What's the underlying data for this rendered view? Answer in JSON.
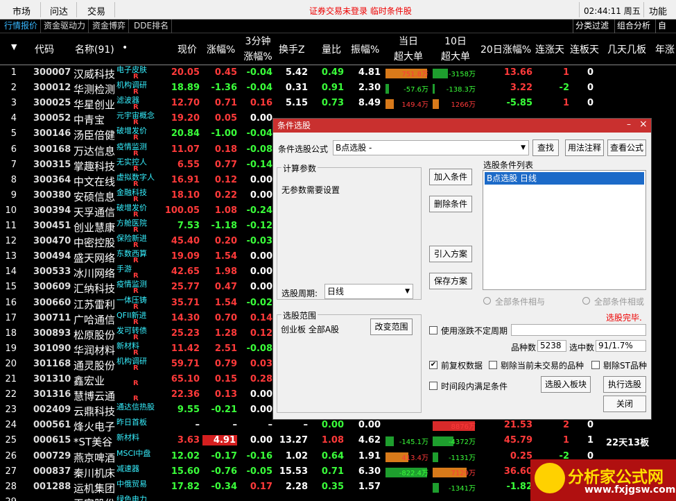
{
  "topbar": {
    "menu": [
      "市场",
      "问达",
      "交易"
    ],
    "notice": "证券交易未登录 临时条件股",
    "clock": "02:44:11 周五",
    "func": "功能"
  },
  "tabs": [
    "行情报价",
    "资金驱动力",
    "资金博弈",
    "DDE排名"
  ],
  "tabs_right": [
    "分类过滤",
    "组合分析",
    "自选"
  ],
  "header": {
    "arrow": "▼",
    "code": "代码",
    "name": "名称(91)",
    "dot": "•",
    "price": "现价",
    "chg": "涨幅%",
    "m3a": "3分钟",
    "m3b": "涨幅%",
    "turnover": "换手Z",
    "vr": "量比",
    "amp": "振幅%",
    "bigA1": "当日",
    "bigA2": "超大单",
    "big10a": "10日",
    "big10b": "超大单",
    "d20": "20日涨幅%",
    "lz": "连涨天",
    "lb": "连板天",
    "jt": "几天几板",
    "nian": "年涨"
  },
  "rows": [
    {
      "n": "1",
      "code": "300007",
      "name": "汉威科技",
      "tag": "电子皮肤",
      "price": "20.05",
      "chg": "0.45",
      "m3": "-0.04",
      "to": "5.42",
      "vr": "0.49",
      "amp": "4.81",
      "b1": "751.8万",
      "b1v": 751.8,
      "b10": "-3158万",
      "b10v": -3158,
      "d20": "13.66",
      "lz": "1",
      "lb": "0",
      "jt": "",
      "r": true
    },
    {
      "n": "2",
      "code": "300012",
      "name": "华测检测",
      "tag": "机构调研",
      "price": "18.89",
      "chg": "-1.36",
      "m3": "-0.04",
      "to": "0.31",
      "vr": "0.91",
      "amp": "2.30",
      "b1": "-57.6万",
      "b1v": -57.6,
      "b10": "-138.3万",
      "b10v": -138.3,
      "d20": "3.22",
      "lz": "-2",
      "lb": "0",
      "jt": "",
      "r": true
    },
    {
      "n": "3",
      "code": "300025",
      "name": "华星创业",
      "tag": "滤波器",
      "price": "12.70",
      "chg": "0.71",
      "m3": "0.16",
      "to": "5.15",
      "vr": "0.73",
      "amp": "8.49",
      "b1": "149.4万",
      "b1v": 149.4,
      "b10": "1266万",
      "b10v": 1266,
      "d20": "-5.85",
      "lz": "1",
      "lb": "0",
      "jt": "",
      "r": true
    },
    {
      "n": "4",
      "code": "300052",
      "name": "中青宝",
      "tag": "元宇宙概念",
      "price": "19.20",
      "chg": "0.05",
      "m3": "0.00",
      "to": "",
      "vr": "",
      "amp": "",
      "b1": "",
      "b1v": 0,
      "b10": "",
      "b10v": 0,
      "d20": "",
      "lz": "",
      "lb": "",
      "jt": "",
      "r": true
    },
    {
      "n": "5",
      "code": "300146",
      "name": "汤臣倍健",
      "tag": "破增发价",
      "price": "20.84",
      "chg": "-1.00",
      "m3": "-0.04",
      "to": "",
      "vr": "",
      "amp": "",
      "b1": "",
      "b1v": 0,
      "b10": "",
      "b10v": 0,
      "d20": "",
      "lz": "",
      "lb": "",
      "jt": "",
      "r": true
    },
    {
      "n": "6",
      "code": "300168",
      "name": "万达信息",
      "tag": "疫情监测",
      "price": "11.07",
      "chg": "0.18",
      "m3": "-0.08",
      "to": "",
      "vr": "",
      "amp": "",
      "b1": "",
      "b1v": 0,
      "b10": "",
      "b10v": 0,
      "d20": "",
      "lz": "",
      "lb": "",
      "jt": "",
      "r": true
    },
    {
      "n": "7",
      "code": "300315",
      "name": "掌趣科技",
      "tag": "无实控人",
      "price": "6.55",
      "chg": "0.77",
      "m3": "-0.14",
      "to": "",
      "vr": "",
      "amp": "",
      "b1": "",
      "b1v": 0,
      "b10": "",
      "b10v": 0,
      "d20": "",
      "lz": "",
      "lb": "",
      "jt": "",
      "r": true
    },
    {
      "n": "8",
      "code": "300364",
      "name": "中文在线",
      "tag": "虚拟数字人",
      "price": "16.91",
      "chg": "0.12",
      "m3": "0.00",
      "to": "",
      "vr": "",
      "amp": "",
      "b1": "",
      "b1v": 0,
      "b10": "",
      "b10v": 0,
      "d20": "",
      "lz": "",
      "lb": "",
      "jt": "",
      "r": true
    },
    {
      "n": "9",
      "code": "300380",
      "name": "安硕信息",
      "tag": "金融科技",
      "price": "18.10",
      "chg": "0.22",
      "m3": "0.00",
      "to": "",
      "vr": "",
      "amp": "",
      "b1": "",
      "b1v": 0,
      "b10": "",
      "b10v": 0,
      "d20": "",
      "lz": "",
      "lb": "",
      "jt": "",
      "r": true
    },
    {
      "n": "10",
      "code": "300394",
      "name": "天孚通信",
      "tag": "破增发价",
      "price": "100.05",
      "chg": "1.08",
      "m3": "-0.24",
      "to": "",
      "vr": "",
      "amp": "",
      "b1": "",
      "b1v": 0,
      "b10": "",
      "b10v": 0,
      "d20": "",
      "lz": "",
      "lb": "",
      "jt": "",
      "r": true
    },
    {
      "n": "11",
      "code": "300451",
      "name": "创业慧康",
      "tag": "方舱医院",
      "price": "7.53",
      "chg": "-1.18",
      "m3": "-0.12",
      "to": "",
      "vr": "",
      "amp": "",
      "b1": "",
      "b1v": 0,
      "b10": "",
      "b10v": 0,
      "d20": "",
      "lz": "",
      "lb": "",
      "jt": "",
      "r": true
    },
    {
      "n": "12",
      "code": "300470",
      "name": "中密控股",
      "tag": "保险新进",
      "price": "45.40",
      "chg": "0.20",
      "m3": "-0.03",
      "to": "",
      "vr": "",
      "amp": "",
      "b1": "",
      "b1v": 0,
      "b10": "",
      "b10v": 0,
      "d20": "",
      "lz": "",
      "lb": "",
      "jt": "",
      "r": true
    },
    {
      "n": "13",
      "code": "300494",
      "name": "盛天网络",
      "tag": "东数西算",
      "price": "19.09",
      "chg": "1.54",
      "m3": "0.00",
      "to": "",
      "vr": "",
      "amp": "",
      "b1": "",
      "b1v": 0,
      "b10": "",
      "b10v": 0,
      "d20": "",
      "lz": "",
      "lb": "",
      "jt": "",
      "r": true
    },
    {
      "n": "14",
      "code": "300533",
      "name": "冰川网络",
      "tag": "手游",
      "price": "42.65",
      "chg": "1.98",
      "m3": "0.00",
      "to": "",
      "vr": "",
      "amp": "",
      "b1": "",
      "b1v": 0,
      "b10": "",
      "b10v": 0,
      "d20": "",
      "lz": "",
      "lb": "",
      "jt": "",
      "r": true
    },
    {
      "n": "15",
      "code": "300609",
      "name": "汇纳科技",
      "tag": "疫情监测",
      "price": "25.77",
      "chg": "0.47",
      "m3": "0.00",
      "to": "",
      "vr": "",
      "amp": "",
      "b1": "",
      "b1v": 0,
      "b10": "",
      "b10v": 0,
      "d20": "",
      "lz": "",
      "lb": "",
      "jt": "",
      "r": true
    },
    {
      "n": "16",
      "code": "300660",
      "name": "江苏雷利",
      "tag": "一体压铸",
      "price": "35.71",
      "chg": "1.54",
      "m3": "-0.02",
      "to": "",
      "vr": "",
      "amp": "",
      "b1": "",
      "b1v": 0,
      "b10": "",
      "b10v": 0,
      "d20": "",
      "lz": "",
      "lb": "",
      "jt": "",
      "r": true
    },
    {
      "n": "17",
      "code": "300711",
      "name": "广哈通信",
      "tag": "QFII新进",
      "price": "14.30",
      "chg": "0.70",
      "m3": "0.14",
      "to": "",
      "vr": "",
      "amp": "",
      "b1": "",
      "b1v": 0,
      "b10": "",
      "b10v": 0,
      "d20": "",
      "lz": "",
      "lb": "",
      "jt": "",
      "r": true
    },
    {
      "n": "18",
      "code": "300893",
      "name": "松原股份",
      "tag": "发可转债",
      "price": "25.23",
      "chg": "1.28",
      "m3": "0.12",
      "to": "",
      "vr": "",
      "amp": "",
      "b1": "",
      "b1v": 0,
      "b10": "",
      "b10v": 0,
      "d20": "",
      "lz": "",
      "lb": "",
      "jt": "",
      "r": true
    },
    {
      "n": "19",
      "code": "301090",
      "name": "华润材料",
      "tag": "新材料",
      "price": "11.42",
      "chg": "2.51",
      "m3": "-0.08",
      "to": "",
      "vr": "",
      "amp": "",
      "b1": "",
      "b1v": 0,
      "b10": "",
      "b10v": 0,
      "d20": "",
      "lz": "",
      "lb": "",
      "jt": "",
      "r": true
    },
    {
      "n": "20",
      "code": "301168",
      "name": "通灵股份",
      "tag": "机构调研",
      "price": "59.71",
      "chg": "0.79",
      "m3": "0.03",
      "to": "",
      "vr": "",
      "amp": "",
      "b1": "",
      "b1v": 0,
      "b10": "",
      "b10v": 0,
      "d20": "",
      "lz": "",
      "lb": "",
      "jt": "",
      "r": true
    },
    {
      "n": "21",
      "code": "301310",
      "name": "鑫宏业",
      "tag": "",
      "price": "65.10",
      "chg": "0.15",
      "m3": "0.28",
      "to": "",
      "vr": "",
      "amp": "",
      "b1": "",
      "b1v": 0,
      "b10": "",
      "b10v": 0,
      "d20": "",
      "lz": "",
      "lb": "",
      "jt": "",
      "r": true
    },
    {
      "n": "22",
      "code": "301316",
      "name": "慧博云通",
      "tag": "",
      "price": "22.36",
      "chg": "0.13",
      "m3": "0.00",
      "to": "",
      "vr": "",
      "amp": "",
      "b1": "",
      "b1v": 0,
      "b10": "",
      "b10v": 0,
      "d20": "",
      "lz": "",
      "lb": "",
      "jt": "",
      "r": true
    },
    {
      "n": "23",
      "code": "002409",
      "name": "云鼎科技",
      "tag": "通达信热股",
      "price": "9.55",
      "chg": "-0.21",
      "m3": "0.00",
      "to": "",
      "vr": "",
      "amp": "",
      "b1": "",
      "b1v": 0,
      "b10": "",
      "b10v": 0,
      "d20": "",
      "lz": "",
      "lb": "",
      "jt": "",
      "r": false
    },
    {
      "n": "24",
      "code": "000561",
      "name": "烽火电子",
      "tag": "昨日首板",
      "price": "–",
      "chg": "–",
      "m3": "–",
      "to": "–",
      "vr": "0.00",
      "amp": "0.00",
      "b1": "",
      "b1v": 0,
      "b10": "8876万",
      "b10v": 8876,
      "d20": "21.53",
      "lz": "2",
      "lb": "0",
      "jt": "",
      "r": false
    },
    {
      "n": "25",
      "code": "000615",
      "name": "*ST美谷",
      "tag": "新材料",
      "price": "3.63",
      "chg": "4.91",
      "m3": "0.00",
      "to": "13.27",
      "vr": "1.08",
      "amp": "4.62",
      "b1": "-145.1万",
      "b1v": -145.1,
      "b10": "-4372万",
      "b10v": -4372,
      "d20": "45.79",
      "lz": "1",
      "lb": "1",
      "jt": "22天13板",
      "r": false
    },
    {
      "n": "26",
      "code": "000729",
      "name": "燕京啤酒",
      "tag": "MSCI中盘",
      "price": "12.02",
      "chg": "-0.17",
      "m3": "-0.16",
      "to": "1.02",
      "vr": "0.64",
      "amp": "1.91",
      "b1": "413.4万",
      "b1v": 413.4,
      "b10": "-1131万",
      "b10v": -1131,
      "d20": "0.25",
      "lz": "-2",
      "lb": "0",
      "jt": "",
      "r": false
    },
    {
      "n": "27",
      "code": "000837",
      "name": "秦川机床",
      "tag": "减速器",
      "price": "15.60",
      "chg": "-0.76",
      "m3": "-0.05",
      "to": "15.53",
      "vr": "0.71",
      "amp": "6.30",
      "b1": "-822.4万",
      "b1v": -822.4,
      "b10": "7129万",
      "b10v": 7129,
      "d20": "36.60",
      "lz": "",
      "lb": "",
      "jt": "",
      "r": false
    },
    {
      "n": "28",
      "code": "001288",
      "name": "运机集团",
      "tag": "中俄贸易",
      "price": "17.82",
      "chg": "-0.34",
      "m3": "0.17",
      "to": "2.28",
      "vr": "0.35",
      "amp": "1.57",
      "b1": "",
      "b1v": 0,
      "b10": "-1341万",
      "b10v": -1341,
      "d20": "-1.82",
      "lz": "",
      "lb": "",
      "jt": "",
      "r": false
    },
    {
      "n": "29",
      "code": "",
      "name": "天安股份",
      "tag": "绿色电力",
      "price": "",
      "chg": "",
      "m3": "",
      "to": "",
      "vr": "",
      "amp": "",
      "b1": "",
      "b1v": 0,
      "b10": "",
      "b10v": 0,
      "d20": "",
      "lz": "",
      "lb": "",
      "jt": "",
      "r": false
    }
  ],
  "dialog": {
    "title": "条件选股",
    "min": "–",
    "close": "×",
    "formula_label": "条件选股公式",
    "formula_value": "B点选股      -",
    "btn_find": "查找",
    "btn_usage": "用法注释",
    "btn_view": "查看公式",
    "calc_label": "计算参数",
    "no_params": "无参数需要设置",
    "period_label": "选股周期:",
    "period_value": "日线",
    "btn_add": "加入条件",
    "btn_del": "删除条件",
    "btn_import": "引入方案",
    "btn_save": "保存方案",
    "list_label": "选股条件列表",
    "list_item": "B点选股  日线",
    "radio_and": "全部条件相与",
    "radio_or": "全部条件相或",
    "status": "选股完毕.",
    "scope_label": "选股范围",
    "scope_value": "创业板 全部A股",
    "btn_scope": "改变范围",
    "cb_uncertain": "使用涨跌不定周期",
    "count_label": "品种数",
    "count_value": "5238",
    "hit_label": "选中数",
    "hit_value": "91/1.7%",
    "cb_restore": "前复权数据",
    "cb_exclude": "剔除当前未交易的品种",
    "cb_st": "剔除ST品种",
    "cb_period": "时间段内满足条件",
    "btn_board": "选股入板块",
    "btn_run": "执行选股",
    "btn_close": "关闭"
  },
  "watermark": {
    "text": "分析家公式网",
    "url": "www.fxjgsw.com"
  }
}
